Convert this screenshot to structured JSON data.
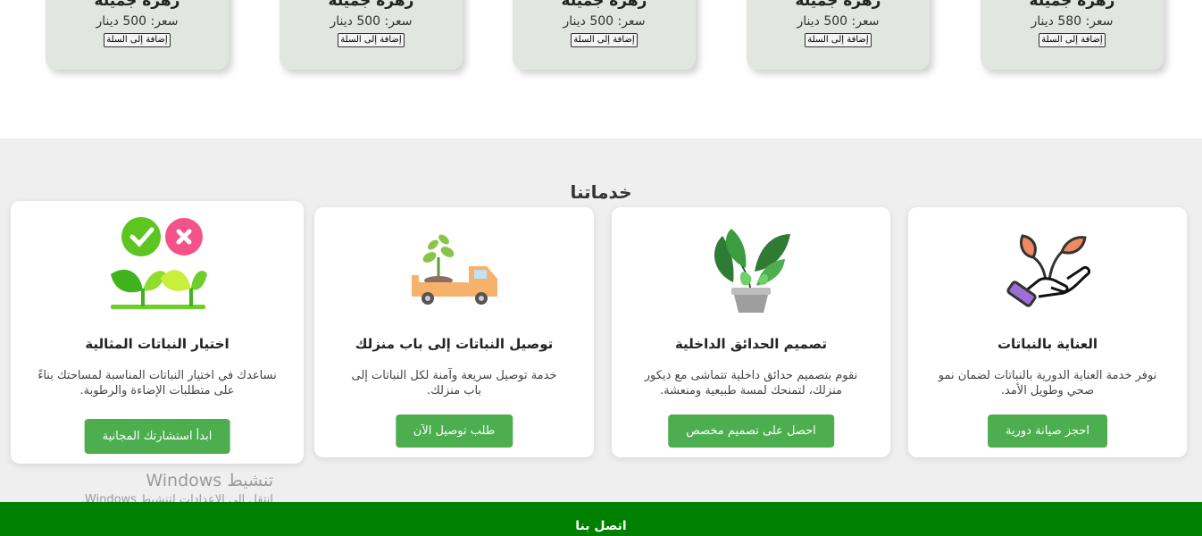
{
  "products": [
    {
      "name": "زهرة جميلة",
      "price": "سعر: 580 دينار",
      "button": "إضافة إلى السلة"
    },
    {
      "name": "زهرة جميلة",
      "price": "سعر: 500 دينار",
      "button": "إضافة إلى السلة"
    },
    {
      "name": "زهرة جميلة",
      "price": "سعر: 500 دينار",
      "button": "إضافة إلى السلة"
    },
    {
      "name": "زهرة جميلة",
      "price": "سعر: 500 دينار",
      "button": "إضافة إلى السلة"
    },
    {
      "name": "زهرة جميلة",
      "price": "سعر: 500 دينار",
      "button": "إضافة إلى السلة"
    }
  ],
  "services": {
    "heading": "خدماتنا",
    "items": [
      {
        "icon": "hand-holding-plant-icon",
        "title": "العناية بالنباتات",
        "desc": "نوفر خدمة العناية الدورية بالنباتات لضمان نمو صحي وطويل الأمد.",
        "button": "احجز صيانة دورية"
      },
      {
        "icon": "potted-plant-icon",
        "title": "تصميم الحدائق الداخلية",
        "desc": "نقوم بتصميم حدائق داخلية تتماشى مع ديكور منزلك، لتمنحك لمسة طبيعية ومنعشة.",
        "button": "احصل على تصميم مخصص"
      },
      {
        "icon": "delivery-truck-plant-icon",
        "title": "توصيل النباتات إلى باب منزلك",
        "desc": "خدمة توصيل سريعة وآمنة لكل النباتات إلى باب منزلك.",
        "button": "طلب توصيل الآن"
      },
      {
        "icon": "plant-choice-check-icon",
        "title": "اختيار النباتات المثالية",
        "desc": "نساعدك في اختيار النباتات المناسبة لمساحتك بناءً على متطلبات الإضاءة والرطوبة.",
        "button": "ابدأ استشارتك المجانية"
      }
    ]
  },
  "watermark": {
    "line1": "تنشيط Windows",
    "line2": "انتقل إلى الإعدادات لتنشيط Windows."
  },
  "footer": {
    "title": "اتصل بنا"
  },
  "colors": {
    "accent": "#4cae4f",
    "footer": "#008000",
    "card": "#e2e6e0",
    "section_bg": "#efefef"
  }
}
